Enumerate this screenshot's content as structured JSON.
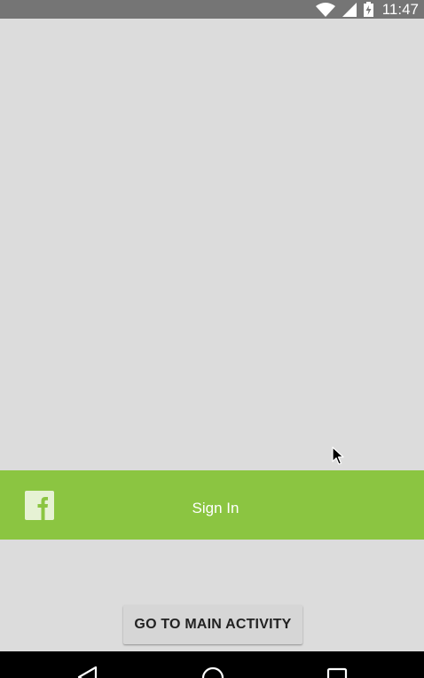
{
  "status_bar": {
    "time": "11:47",
    "icons": [
      "wifi-icon",
      "cell-signal-icon",
      "battery-charging-icon"
    ]
  },
  "login": {
    "provider_icon": "facebook-icon",
    "sign_in_label": "Sign In"
  },
  "actions": {
    "main_activity_label": "GO TO MAIN ACTIVITY"
  },
  "nav_bar": {
    "icons": [
      "back-icon",
      "home-icon",
      "recents-icon"
    ]
  },
  "colors": {
    "background": "#dcdcdc",
    "status_bar": "#757575",
    "signin_bar": "#8bc541",
    "button": "#d6d6d6",
    "nav_bar": "#000000"
  }
}
